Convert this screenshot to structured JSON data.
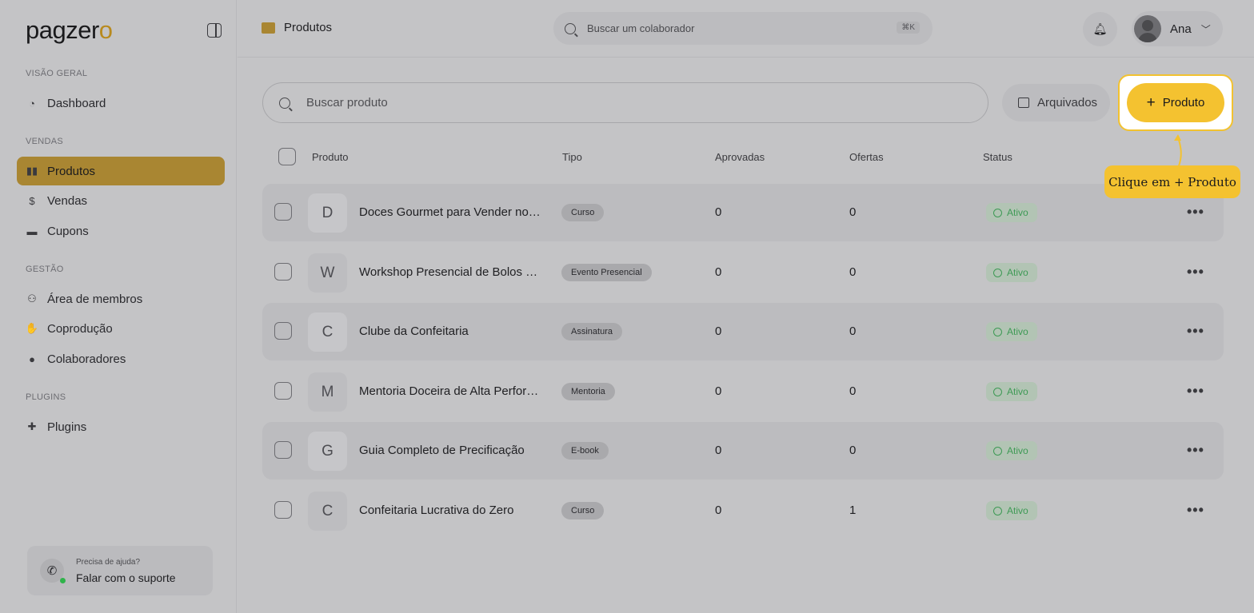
{
  "brand": {
    "logo_main": "pagzer",
    "logo_accent": "o"
  },
  "sidebar": {
    "sections": [
      {
        "label": "VISÃO GERAL"
      },
      {
        "label": "VENDAS"
      },
      {
        "label": "GESTÃO"
      },
      {
        "label": "PLUGINS"
      }
    ],
    "items": [
      {
        "label": "Dashboard",
        "icon": "dashboard-icon",
        "active": false
      },
      {
        "label": "Produtos",
        "icon": "products-icon",
        "active": true
      },
      {
        "label": "Vendas",
        "icon": "sales-icon",
        "active": false
      },
      {
        "label": "Cupons",
        "icon": "coupon-icon",
        "active": false
      },
      {
        "label": "Área de membros",
        "icon": "members-icon",
        "active": false
      },
      {
        "label": "Coprodução",
        "icon": "handshake-icon",
        "active": false
      },
      {
        "label": "Colaboradores",
        "icon": "user-icon",
        "active": false
      },
      {
        "label": "Plugins",
        "icon": "puzzle-icon",
        "active": false
      }
    ],
    "support": {
      "question": "Precisa de ajuda?",
      "cta": "Falar com o suporte",
      "icon": "whatsapp-icon"
    }
  },
  "header": {
    "breadcrumb": "Produtos",
    "search_placeholder": "Buscar um colaborador",
    "search_shortcut": "⌘K",
    "user_name": "Ana"
  },
  "toolbar": {
    "search_placeholder": "Buscar produto",
    "archived_label": "Arquivados",
    "add_label": "Produto"
  },
  "table": {
    "columns": [
      "Produto",
      "Tipo",
      "Aprovadas",
      "Ofertas",
      "Status"
    ],
    "rows": [
      {
        "initial": "D",
        "name": "Doces Gourmet para Vender no N...",
        "type": "Curso",
        "approved": "0",
        "offers": "0",
        "status": "Ativo"
      },
      {
        "initial": "W",
        "name": "Workshop Presencial de Bolos Vu...",
        "type": "Evento Presencial",
        "approved": "0",
        "offers": "0",
        "status": "Ativo"
      },
      {
        "initial": "C",
        "name": "Clube da Confeitaria",
        "type": "Assinatura",
        "approved": "0",
        "offers": "0",
        "status": "Ativo"
      },
      {
        "initial": "M",
        "name": "Mentoria Doceira de Alta Perform...",
        "type": "Mentoria",
        "approved": "0",
        "offers": "0",
        "status": "Ativo"
      },
      {
        "initial": "G",
        "name": "Guia Completo de Precificação",
        "type": "E-book",
        "approved": "0",
        "offers": "0",
        "status": "Ativo"
      },
      {
        "initial": "C",
        "name": "Confeitaria Lucrativa do Zero",
        "type": "Curso",
        "approved": "0",
        "offers": "1",
        "status": "Ativo"
      }
    ]
  },
  "tooltip": {
    "text": "Clique em + Produto"
  },
  "colors": {
    "accent": "#f4c230",
    "active_nav": "#a98632",
    "status_green": "#3e9a55"
  }
}
